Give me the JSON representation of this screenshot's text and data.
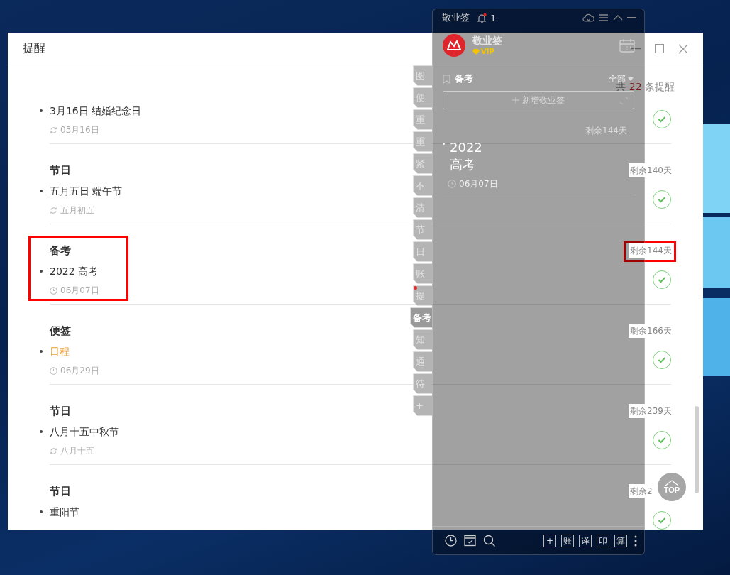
{
  "window": {
    "title": "提醒"
  },
  "summary": {
    "prefix": "共",
    "count": "22",
    "suffix": "条提醒"
  },
  "groups": [
    {
      "item": {
        "text": "3月16日 结婚纪念日",
        "color": "#333333"
      },
      "sub": {
        "kind": "repeat",
        "text": "03月16日"
      },
      "highlighted": false
    },
    {
      "heading": "节日",
      "item": {
        "text": "五月五日 端午节",
        "color": "#333333"
      },
      "sub": {
        "kind": "repeat",
        "text": "五月初五"
      },
      "days": "剩余140天",
      "highlighted": false
    },
    {
      "heading": "备考",
      "item": {
        "text": "2022 高考",
        "color": "#333333"
      },
      "sub": {
        "kind": "clock",
        "text": "06月07日"
      },
      "days": "剩余144天",
      "highlighted": true
    },
    {
      "heading": "便签",
      "item": {
        "text": "日程",
        "color": "#e8a23a"
      },
      "sub": {
        "kind": "clock",
        "text": "06月29日"
      },
      "days": "剩余166天",
      "highlighted": false
    },
    {
      "heading": "节日",
      "item": {
        "text": "八月十五中秋节",
        "color": "#333333"
      },
      "sub": {
        "kind": "repeat",
        "text": "八月十五"
      },
      "days": "剩余239天",
      "highlighted": false
    },
    {
      "heading": "节日",
      "item": {
        "text": "重阳节",
        "color": "#333333"
      },
      "days": "剩余2",
      "highlighted": false
    }
  ],
  "top_button": "TOP",
  "tabs": [
    {
      "label": "图",
      "selected": false,
      "badge": false
    },
    {
      "label": "便",
      "selected": false,
      "badge": false
    },
    {
      "label": "重",
      "selected": false,
      "badge": false
    },
    {
      "label": "重",
      "selected": false,
      "badge": false
    },
    {
      "label": "紧",
      "selected": false,
      "badge": false
    },
    {
      "label": "不",
      "selected": false,
      "badge": false
    },
    {
      "label": "清",
      "selected": false,
      "badge": false
    },
    {
      "label": "节",
      "selected": false,
      "badge": false
    },
    {
      "label": "日",
      "selected": false,
      "badge": false
    },
    {
      "label": "账",
      "selected": false,
      "badge": false
    },
    {
      "label": "提",
      "selected": false,
      "badge": true
    },
    {
      "label": "备考",
      "selected": true,
      "badge": false
    },
    {
      "label": "知",
      "selected": false,
      "badge": false
    },
    {
      "label": "通",
      "selected": false,
      "badge": false
    },
    {
      "label": "待",
      "selected": false,
      "badge": false
    },
    {
      "label": "+",
      "selected": false,
      "badge": false
    }
  ],
  "panel": {
    "app_name": "敬业签",
    "notification_count": "1",
    "brand": "敬业签",
    "vip": "VIP",
    "category": "备考",
    "filter": "全部",
    "new_button": "新增敬业签",
    "notes": [
      {
        "days": "剩余144天",
        "text": "2022 高考",
        "date": "06月07日"
      }
    ],
    "toolbar": [
      "+",
      "账",
      "译",
      "印",
      "算"
    ]
  }
}
